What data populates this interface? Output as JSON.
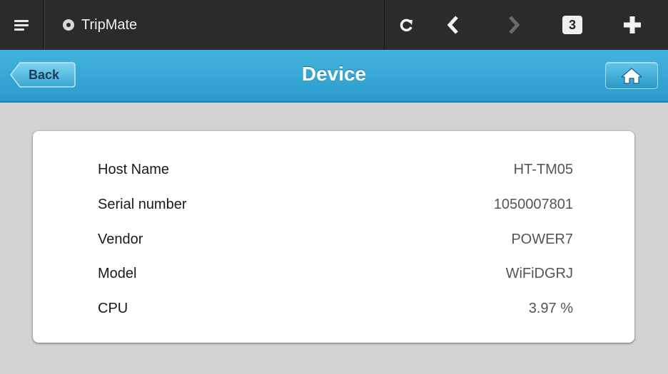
{
  "browser": {
    "tab_title": "TripMate",
    "tab_count": "3"
  },
  "header": {
    "back_label": "Back",
    "title": "Device"
  },
  "device_info": [
    {
      "label": "Host Name",
      "value": "HT-TM05"
    },
    {
      "label": "Serial number",
      "value": "1050007801"
    },
    {
      "label": "Vendor",
      "value": "POWER7"
    },
    {
      "label": "Model",
      "value": "WiFiDGRJ"
    },
    {
      "label": "CPU",
      "value": "3.97 %"
    }
  ],
  "colors": {
    "topbar": "#2b2b2b",
    "accent_blue": "#2a9bcc",
    "background": "#d3d3d3",
    "card": "#ffffff"
  },
  "icons": [
    "menu-icon",
    "tab-favicon-icon",
    "reload-icon",
    "back-arrow-icon",
    "forward-arrow-icon",
    "tabs-count-icon",
    "new-tab-plus-icon",
    "home-icon"
  ]
}
